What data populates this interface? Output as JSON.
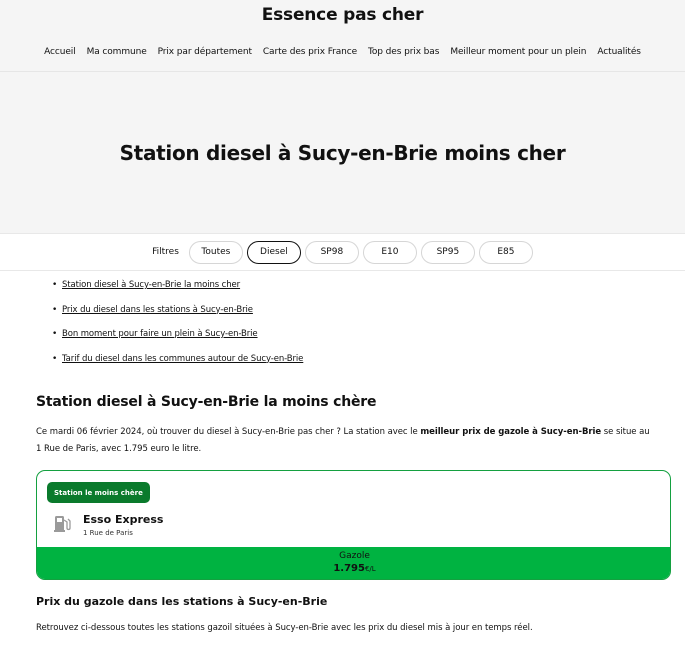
{
  "site": {
    "title": "Essence pas cher"
  },
  "nav": [
    "Accueil",
    "Ma commune",
    "Prix par département",
    "Carte des prix France",
    "Top des prix bas",
    "Meilleur moment pour un plein",
    "Actualités"
  ],
  "hero": {
    "title": "Station diesel à Sucy-en-Brie moins cher"
  },
  "filters": {
    "label": "Filtres",
    "options": [
      "Toutes",
      "Diesel",
      "SP98",
      "E10",
      "SP95",
      "E85"
    ],
    "selected": "Diesel"
  },
  "toc": [
    "Station diesel à Sucy-en-Brie la moins cher",
    "Prix du diesel dans les stations à Sucy-en-Brie",
    "Bon moment pour faire un plein à Sucy-en-Brie",
    "Tarif du diesel dans les communes autour de Sucy-en-Brie"
  ],
  "section1": {
    "title": "Station diesel à Sucy-en-Brie la moins chère",
    "text_before": "Ce mardi 06 février 2024, où trouver du diesel à Sucy-en-Brie pas cher ? La station avec le ",
    "text_bold": "meilleur prix de gazole à Sucy-en-Brie",
    "text_after": " se situe au 1 Rue de Paris, avec 1.795 euro le litre."
  },
  "card": {
    "badge": "Station le moins chère",
    "icon": "fuel-pump-icon",
    "name": "Esso Express",
    "address": "1 Rue de Paris",
    "fuel": "Gazole",
    "price": "1.795",
    "unit": "€/L",
    "accent": "#00b341",
    "badge_color": "#0a7a2c"
  },
  "section2": {
    "title": "Prix du gazole dans les stations à Sucy-en-Brie",
    "text": "Retrouvez ci-dessous toutes les stations gazoil situées à Sucy-en-Brie avec les prix du diesel mis à jour en temps réel."
  }
}
